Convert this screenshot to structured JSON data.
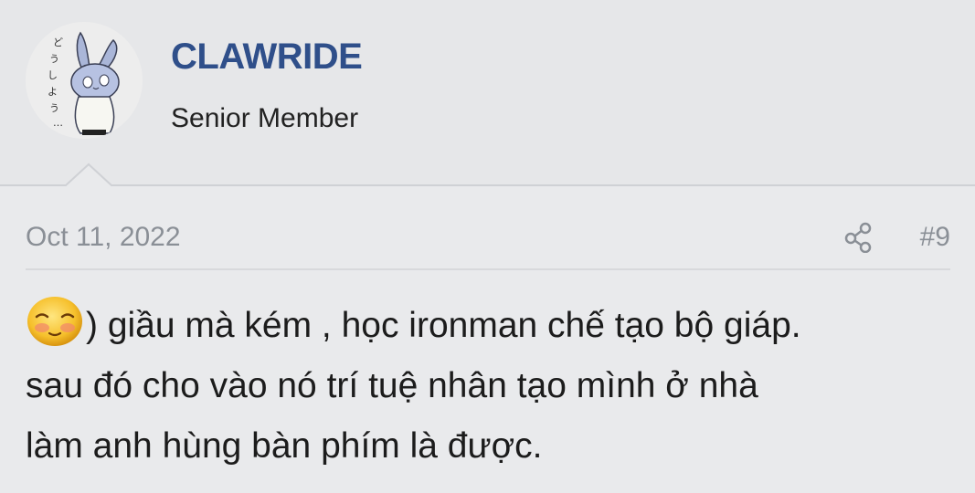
{
  "user": {
    "name": "CLAWRIDE",
    "title": "Senior Member",
    "avatar_text": "どうしよう…"
  },
  "post": {
    "date": "Oct 11, 2022",
    "number": "#9",
    "share_icon": "share-icon",
    "body_lines": [
      ") giầu mà kém , học ironman chế tạo bộ giáp.",
      "sau đó cho vào nó trí tuệ nhân tạo mình ở nhà",
      "làm anh hùng bàn phím là được."
    ],
    "emoji": "blushing-smiley-icon"
  },
  "colors": {
    "username": "#2f4f8a",
    "meta_text": "#8a8f96",
    "background": "#e9eaec",
    "divider": "#cfd1d5"
  }
}
